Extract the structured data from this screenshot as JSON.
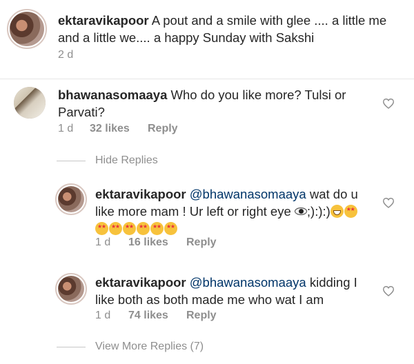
{
  "caption": {
    "username": "ektaravikapoor",
    "text": "A pout and a smile with glee .... a little me and a little we.... a happy Sunday with Sakshi",
    "time": "2 d"
  },
  "comment": {
    "username": "bhawanasomaaya",
    "text": "Who do you like more? Tulsi or Parvati?",
    "time": "1 d",
    "likes": "32 likes",
    "reply_label": "Reply"
  },
  "hide_replies": "Hide Replies",
  "replies": [
    {
      "username": "ektaravikapoor",
      "mention": "@bhawanasomaaya",
      "text": "wat do u like more mam ! Ur left or right eye",
      "text_after_eye": ";):):)",
      "emoji_line1": [
        "grin-face",
        "star-struck"
      ],
      "emoji_line2": [
        "star-struck",
        "star-struck",
        "star-struck",
        "star-struck",
        "star-struck",
        "star-struck"
      ],
      "time": "1 d",
      "likes": "16 likes",
      "reply_label": "Reply"
    },
    {
      "username": "ektaravikapoor",
      "mention": "@bhawanasomaaya",
      "text": "kidding I like both as both made me who wat I am",
      "time": "1 d",
      "likes": "74 likes",
      "reply_label": "Reply"
    }
  ],
  "view_more_replies": "View More Replies (7)",
  "colors": {
    "mention": "#003569",
    "meta": "#8e8e8e",
    "text": "#262626"
  }
}
